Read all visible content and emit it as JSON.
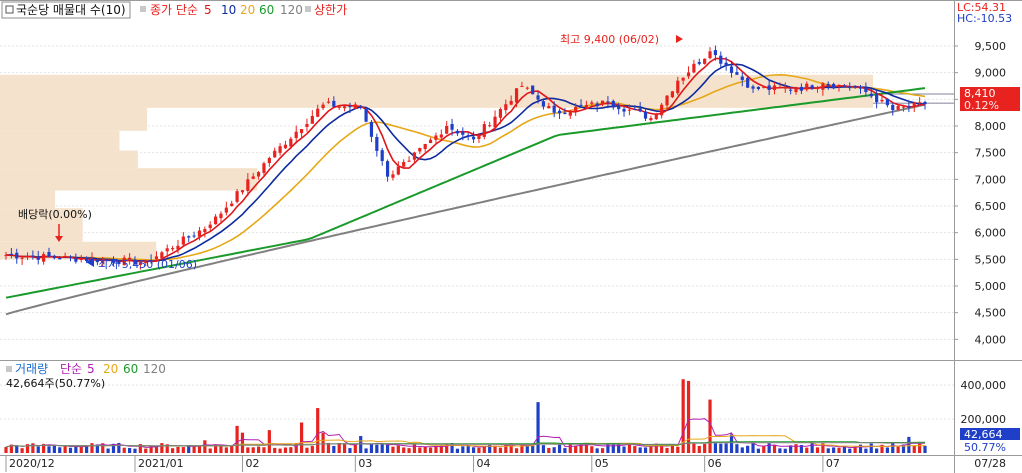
{
  "header": {
    "title_box": "국순당 매물대 수(10)",
    "price_label": "종가 단순",
    "ma_periods": [
      "5",
      "10",
      "20",
      "60",
      "120"
    ],
    "limit_label": "상한가"
  },
  "right_header": {
    "lc": "LC:54.31",
    "hc": "HC:-10.53"
  },
  "volume_header": {
    "label": "거래량",
    "ma_label": "단순",
    "ma_periods": [
      "5",
      "20",
      "60",
      "120"
    ],
    "value_line": "42,664주(50.77%)"
  },
  "annotations": {
    "dividend": "배당락(0.00%)",
    "low": "최저 5,450 (01/06)",
    "high": "최고 9,400 (06/02)"
  },
  "current_price": {
    "price": "8,410",
    "change": "0.12%"
  },
  "current_volume": {
    "volume": "42,664",
    "ratio": "50.77%"
  },
  "colors": {
    "up": "#e8231f",
    "down": "#1f3fc8",
    "ma5": "#e0161b",
    "ma10": "#0d2a9e",
    "ma20": "#e6a817",
    "ma60": "#1a9a2a",
    "ma120": "#808080",
    "vma5": "#b21fb2",
    "profile": "#f5e2cc",
    "grid": "#e4e4e4",
    "axis": "#9a9a9a"
  },
  "chart_data": [
    {
      "type": "candlestick",
      "title": "국순당 매물대 수(10)",
      "series_names": [
        "종가 단순 5",
        "10",
        "20",
        "60",
        "120"
      ],
      "y_axis_ticks": [
        4000,
        4500,
        5000,
        5500,
        6000,
        6500,
        7000,
        7500,
        8000,
        8500,
        9000,
        9500
      ],
      "ylim": [
        3800,
        9800
      ],
      "x_axis_labels": [
        "2020/12",
        "2021/01",
        "02",
        "03",
        "04",
        "05",
        "06",
        "07",
        "07/28"
      ],
      "waypoints": [
        [
          "2020-12-01",
          5580
        ],
        [
          "2021-01-06",
          5450
        ],
        [
          "2021-01-22",
          6150
        ],
        [
          "2021-02-08",
          7400
        ],
        [
          "2021-02-22",
          8400
        ],
        [
          "2021-03-03",
          8350
        ],
        [
          "2021-03-10",
          7050
        ],
        [
          "2021-03-16",
          7350
        ],
        [
          "2021-03-25",
          8000
        ],
        [
          "2021-04-01",
          7750
        ],
        [
          "2021-04-14",
          8750
        ],
        [
          "2021-04-22",
          8250
        ],
        [
          "2021-05-06",
          8450
        ],
        [
          "2021-05-18",
          8150
        ],
        [
          "2021-05-25",
          8850
        ],
        [
          "2021-06-02",
          9400
        ],
        [
          "2021-06-14",
          8700
        ],
        [
          "2021-06-24",
          8700
        ],
        [
          "2021-07-01",
          8800
        ],
        [
          "2021-07-12",
          8700
        ],
        [
          "2021-07-20",
          8300
        ],
        [
          "2021-07-28",
          8410
        ]
      ],
      "volume_profile": [
        {
          "price_low": 8340,
          "price_high": 8960,
          "strength": 0.95
        },
        {
          "price_low": 7910,
          "price_high": 8340,
          "strength": 0.16
        },
        {
          "price_low": 7540,
          "price_high": 7910,
          "strength": 0.13
        },
        {
          "price_low": 7210,
          "price_high": 7540,
          "strength": 0.15
        },
        {
          "price_low": 6790,
          "price_high": 7210,
          "strength": 0.28
        },
        {
          "price_low": 6460,
          "price_high": 6790,
          "strength": 0.06
        },
        {
          "price_low": 5830,
          "price_high": 6460,
          "strength": 0.09
        },
        {
          "price_low": 5500,
          "price_high": 5830,
          "strength": 0.17
        }
      ],
      "last_price": 8410,
      "low": {
        "value": 5450,
        "date": "01/06"
      },
      "high": {
        "value": 9400,
        "date": "06/02"
      }
    },
    {
      "type": "bar",
      "title": "거래량",
      "series_names": [
        "거래량",
        "단순 5",
        "20",
        "60",
        "120"
      ],
      "y_axis_ticks": [
        200000,
        400000
      ],
      "ylim": [
        0,
        460000
      ],
      "spikes": [
        {
          "date": "2021-01-21",
          "value": 75000
        },
        {
          "date": "2021-01-29",
          "value": 160000
        },
        {
          "date": "2021-02-01",
          "value": 120000
        },
        {
          "date": "2021-02-08",
          "value": 135000
        },
        {
          "date": "2021-02-16",
          "value": 180000
        },
        {
          "date": "2021-02-19",
          "value": 265000
        },
        {
          "date": "2021-02-22",
          "value": 120000
        },
        {
          "date": "2021-03-03",
          "value": 100000
        },
        {
          "date": "2021-04-19",
          "value": 300000
        },
        {
          "date": "2021-05-26",
          "value": 435000
        },
        {
          "date": "2021-05-27",
          "value": 425000
        },
        {
          "date": "2021-06-02",
          "value": 315000
        },
        {
          "date": "2021-06-08",
          "value": 110000
        },
        {
          "date": "2021-07-23",
          "value": 95000
        }
      ],
      "last_value": 42664,
      "last_ratio": "50.77%"
    }
  ]
}
